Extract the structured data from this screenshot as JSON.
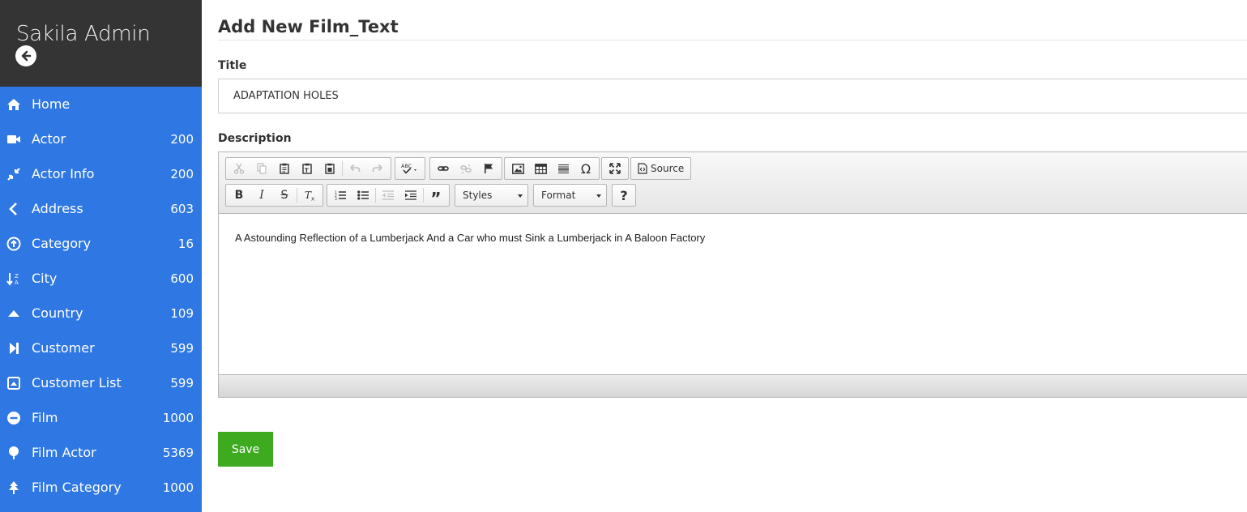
{
  "app": {
    "title": "Sakila Admin",
    "back_icon": "arrow-left-circle-icon"
  },
  "sidebar": {
    "items": [
      {
        "label": "Home",
        "count": "",
        "icon": "home-icon"
      },
      {
        "label": "Actor",
        "count": "200",
        "icon": "video-camera-icon"
      },
      {
        "label": "Actor Info",
        "count": "200",
        "icon": "compress-arrows-icon"
      },
      {
        "label": "Address",
        "count": "603",
        "icon": "chevron-left-icon"
      },
      {
        "label": "Category",
        "count": "16",
        "icon": "arrow-circle-up-icon"
      },
      {
        "label": "City",
        "count": "600",
        "icon": "sort-alpha-down-icon"
      },
      {
        "label": "Country",
        "count": "109",
        "icon": "caret-up-icon"
      },
      {
        "label": "Customer",
        "count": "599",
        "icon": "step-forward-icon"
      },
      {
        "label": "Customer List",
        "count": "599",
        "icon": "caret-square-up-icon"
      },
      {
        "label": "Film",
        "count": "1000",
        "icon": "minus-circle-icon"
      },
      {
        "label": "Film Actor",
        "count": "5369",
        "icon": "tree-icon"
      },
      {
        "label": "Film Category",
        "count": "1000",
        "icon": "pine-tree-icon"
      }
    ]
  },
  "main": {
    "page_title": "Add New Film_Text",
    "title_label": "Title",
    "title_value": "ADAPTATION HOLES",
    "description_label": "Description",
    "description_value": "A Astounding Reflection of a Lumberjack And a Car who must Sink a Lumberjack in A Baloon Factory",
    "save_label": "Save"
  },
  "editor": {
    "source_label": "Source",
    "styles_label": "Styles",
    "format_label": "Format",
    "help_label": "?"
  },
  "colors": {
    "sidebar_bg": "#2f77e3",
    "sidebar_header_bg": "#343434",
    "save_button_bg": "#3daa1f"
  }
}
